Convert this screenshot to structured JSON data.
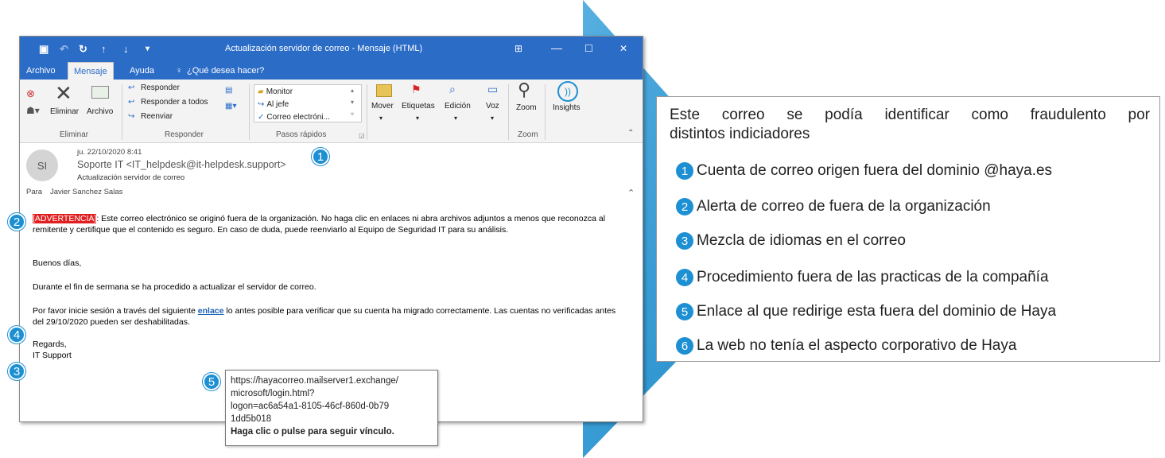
{
  "window": {
    "title": "Actualización servidor de correo  -  Mensaje (HTML)",
    "controls": [
      "⊞",
      "—",
      "☐",
      "✕"
    ]
  },
  "tabs": [
    "Archivo",
    "Mensaje",
    "Ayuda",
    "¿Qué desea hacer?"
  ],
  "ribbon": {
    "delete_group": {
      "delete": "Eliminar",
      "archive": "Archivo",
      "label": "Eliminar"
    },
    "respond_group": {
      "reply": "Responder",
      "reply_all": "Responder a todos",
      "forward": "Reenviar",
      "label": "Responder"
    },
    "quick_steps": {
      "items": [
        "Monitor",
        "Al jefe",
        "Correo electróni..."
      ],
      "label": "Pasos rápidos"
    },
    "move": "Mover",
    "tags": "Etiquetas",
    "edit": "Edición",
    "voice": "Voz",
    "zoom": "Zoom",
    "insights": "Insights",
    "zoom_label": "Zoom"
  },
  "message": {
    "date": "ju. 22/10/2020 8:41",
    "sender": "Soporte IT <IT_helpdesk@it-helpdesk.support>",
    "subject": "Actualización servidor de correo",
    "to_label": "Para",
    "to": "Javier Sanchez Salas",
    "avatar": "SI",
    "warning_tag": "[ADVERTENCIA]",
    "warning_text": ": Este correo electrónico se originó fuera de la organización. No haga clic en enlaces ni abra archivos adjuntos a menos que reconozca al remitente y certifique que el contenido es seguro. En caso de duda, puede reenviarlo al Equipo de Seguridad IT para su análisis.",
    "greeting": "Buenos días,",
    "line1": "Durante el fin de sermana se ha procedido a actualizar el servidor de correo.",
    "line2_pre": "Por favor inicie sesión a través del siguiente ",
    "link_text": "enlace",
    "line2_post": " lo antes posible para verificar que su cuenta ha migrado correctamente. Las cuentas no verificadas antes del 29/10/2020 pueden ser deshabilitadas.",
    "sign1": "Regards,",
    "sign2": "IT Support"
  },
  "tooltip": {
    "url_lines": [
      "https://hayacorreo.mailserver1.exchange/",
      "microsoft/login.html?",
      "logon=ac6a54a1-8105-46cf-860d-0b79",
      "1dd5b018"
    ],
    "hint": "Haga clic o pulse para seguir vínculo."
  },
  "badges": [
    "1",
    "2",
    "3",
    "4",
    "5"
  ],
  "panel": {
    "intro_line1": "Este correo se podía identificar como fraudulento por",
    "intro_line2": "distintos indiciadores",
    "items": [
      {
        "num": "1",
        "text": "Cuenta de correo origen fuera del dominio @haya.es"
      },
      {
        "num": "2",
        "text": "Alerta de correo de fuera de la organización"
      },
      {
        "num": "3",
        "text": "Mezcla de idiomas en el correo"
      },
      {
        "num": "4",
        "text": "Procedimiento fuera de las practicas de la compañía"
      },
      {
        "num": "5",
        "text": "Enlace al que redirige esta fuera del dominio de Haya"
      },
      {
        "num": "6",
        "text": "La web no tenía el aspecto corporativo de Haya"
      }
    ]
  },
  "colors": {
    "accent": "#2b6cc7",
    "badge": "#1d8fd3",
    "arrow": "#1e95d6",
    "warning": "#e02020"
  }
}
